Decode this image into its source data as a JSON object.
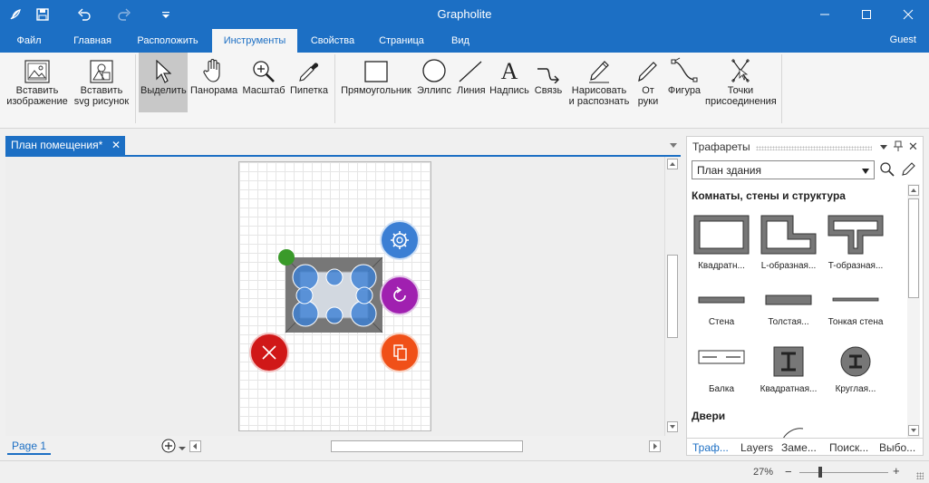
{
  "app": {
    "title": "Grapholite",
    "user": "Guest"
  },
  "menu_tabs": [
    "Файл",
    "Главная",
    "Расположить",
    "Инструменты",
    "Свойства",
    "Страница",
    "Вид"
  ],
  "ribbon": {
    "insert_image": "Вставить\nизображение",
    "insert_svg": "Вставить\nsvg рисунок",
    "select": "Выделить",
    "pan": "Панорама",
    "zoom": "Масштаб",
    "pipette": "Пипетка",
    "rectangle": "Прямоугольник",
    "ellipse": "Эллипс",
    "line": "Линия",
    "text": "Надпись",
    "link": "Связь",
    "draw_recognize": "Нарисовать\nи распознать",
    "freehand": "От\nруки",
    "shape": "Фигура",
    "connection_points": "Точки\nприсоединения"
  },
  "document": {
    "tab_title": "План помещения*",
    "page_tab": "Page 1"
  },
  "stencils": {
    "header": "Трафареты",
    "selected_set": "План здания",
    "section_rooms": "Комнаты, стены и структура",
    "section_doors": "Двери",
    "items": [
      "Квадратн...",
      "L-образная...",
      "T-образная...",
      "Стена",
      "Толстая...",
      "Тонкая стена",
      "Балка",
      "Квадратная...",
      "Круглая..."
    ],
    "bottom_tabs": [
      "Траф...",
      "Layers",
      "Заме...",
      "Поиск...",
      "Выбо..."
    ]
  },
  "status": {
    "zoom": "27%"
  },
  "colors": {
    "accent": "#1c6fc4",
    "gear_button": "#3b7fd4",
    "rotate_button": "#a020b0",
    "delete_button": "#d01818",
    "copy_button": "#f05018",
    "handle_green": "#3a9a2a"
  }
}
